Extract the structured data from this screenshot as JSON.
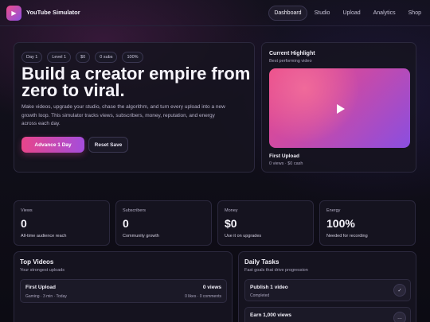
{
  "app": {
    "title": "YouTube Simulator",
    "logo_icon": "▶"
  },
  "nav": {
    "items": [
      {
        "label": "Dashboard",
        "active": true
      },
      {
        "label": "Studio"
      },
      {
        "label": "Upload"
      },
      {
        "label": "Analytics"
      },
      {
        "label": "Shop"
      }
    ]
  },
  "hero": {
    "chips": [
      "Day 1",
      "Level 1",
      "$0",
      "0 subs",
      "100%"
    ],
    "title": "Build a creator empire from zero to viral.",
    "description": "Make videos, upgrade your studio, chase the algorithm, and turn every upload into a new growth loop. This simulator tracks views, subscribers, money, reputation, and energy across each day.",
    "primary_button": "Advance 1 Day",
    "secondary_button": "Reset Save"
  },
  "highlight": {
    "title": "Current Highlight",
    "subtitle": "Best performing video",
    "video_title": "First Upload",
    "video_meta": "0 views · $0 cash",
    "play_icon": "play-icon"
  },
  "stats": [
    {
      "label": "Views",
      "value": "0",
      "note": "All-time audience reach"
    },
    {
      "label": "Subscribers",
      "value": "0",
      "note": "Community growth"
    },
    {
      "label": "Money",
      "value": "$0",
      "note": "Use it on upgrades"
    },
    {
      "label": "Energy",
      "value": "100%",
      "note": "Needed for recording"
    }
  ],
  "top_videos": {
    "title": "Top Videos",
    "subtitle": "Your strongest uploads",
    "items": [
      {
        "title": "First Upload",
        "meta": "Gaming · 3 min · Today",
        "views": "0 views",
        "stats": "0 likes · 0 comments"
      }
    ]
  },
  "daily_tasks": {
    "title": "Daily Tasks",
    "subtitle": "Fast goals that drive progression",
    "items": [
      {
        "title": "Publish 1 video",
        "status": "Completed",
        "badge": "✓"
      },
      {
        "title": "Earn 1,000 views",
        "status": "",
        "badge": "…"
      }
    ]
  },
  "colors": {
    "accent_start": "#e8458a",
    "accent_end": "#a44ddc",
    "background": "#0d0c15"
  }
}
